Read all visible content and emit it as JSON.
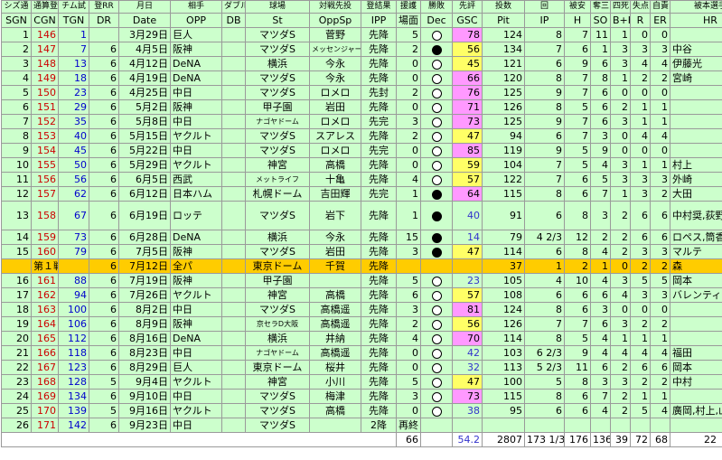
{
  "headers": {
    "row1": [
      "シズ通",
      "通算登",
      "チム試",
      "登RR",
      "月日",
      "相手",
      "ダブル",
      "球場",
      "対戦先投",
      "登結果",
      "援護",
      "勝敗",
      "先評",
      "投数",
      "回",
      "被安",
      "奪三",
      "四死",
      "失点",
      "自責",
      "被本選手"
    ],
    "row2": [
      "SGN",
      "CGN",
      "TGN",
      "DR",
      "Date",
      "OPP",
      "DB",
      "St",
      "OppSp",
      "IPP",
      "場面",
      "Dec",
      "GSC",
      "Pit",
      "IP",
      "H",
      "SO",
      "B+H",
      "R",
      "ER",
      "HR"
    ]
  },
  "rows": [
    {
      "sgn": "1",
      "cgn": "146",
      "tgn": "1",
      "dr": "",
      "date": "3月29日",
      "opp": "巨人",
      "db": "",
      "st": "マツダS",
      "oppsp": "菅野",
      "ipp": "先降",
      "run": "5",
      "dec": "nd",
      "gsc": "78",
      "pit": "124",
      "ip": "8",
      "h": "7",
      "so": "11",
      "bb": "1",
      "r": "0",
      "er": "0",
      "hr": ""
    },
    {
      "sgn": "2",
      "cgn": "147",
      "tgn": "7",
      "dr": "6",
      "date": "4月5日",
      "opp": "阪神",
      "db": "",
      "st": "マツダS",
      "oppsp": "メッセンジャー",
      "ipp": "先降",
      "run": "2",
      "dec": "win",
      "gsc": "56",
      "pit": "134",
      "ip": "7",
      "h": "6",
      "so": "1",
      "bb": "3",
      "r": "3",
      "er": "3",
      "hr": "中谷"
    },
    {
      "sgn": "3",
      "cgn": "148",
      "tgn": "13",
      "dr": "6",
      "date": "4月12日",
      "opp": "DeNA",
      "db": "",
      "st": "横浜",
      "oppsp": "今永",
      "ipp": "先降",
      "run": "0",
      "dec": "nd",
      "gsc": "45",
      "pit": "121",
      "ip": "6",
      "h": "9",
      "so": "6",
      "bb": "3",
      "r": "4",
      "er": "4",
      "hr": "伊藤光"
    },
    {
      "sgn": "4",
      "cgn": "149",
      "tgn": "18",
      "dr": "6",
      "date": "4月19日",
      "opp": "DeNA",
      "db": "",
      "st": "マツダS",
      "oppsp": "今永",
      "ipp": "先降",
      "run": "0",
      "dec": "nd",
      "gsc": "66",
      "pit": "120",
      "ip": "8",
      "h": "7",
      "so": "8",
      "bb": "1",
      "r": "2",
      "er": "2",
      "hr": "宮崎"
    },
    {
      "sgn": "5",
      "cgn": "150",
      "tgn": "23",
      "dr": "6",
      "date": "4月25日",
      "opp": "中日",
      "db": "",
      "st": "マツダS",
      "oppsp": "ロメロ",
      "ipp": "先封",
      "run": "2",
      "dec": "nd",
      "gsc": "76",
      "pit": "125",
      "ip": "9",
      "h": "7",
      "so": "6",
      "bb": "0",
      "r": "0",
      "er": "0",
      "hr": ""
    },
    {
      "sgn": "6",
      "cgn": "151",
      "tgn": "29",
      "dr": "6",
      "date": "5月2日",
      "opp": "阪神",
      "db": "",
      "st": "甲子園",
      "oppsp": "岩田",
      "ipp": "先降",
      "run": "0",
      "dec": "nd",
      "gsc": "71",
      "pit": "126",
      "ip": "8",
      "h": "5",
      "so": "6",
      "bb": "2",
      "r": "1",
      "er": "1",
      "hr": ""
    },
    {
      "sgn": "7",
      "cgn": "152",
      "tgn": "35",
      "dr": "6",
      "date": "5月8日",
      "opp": "中日",
      "db": "",
      "st": "ナゴヤドーム",
      "oppsp": "ロメロ",
      "ipp": "先完",
      "run": "3",
      "dec": "nd",
      "gsc": "73",
      "pit": "125",
      "ip": "9",
      "h": "7",
      "so": "6",
      "bb": "3",
      "r": "1",
      "er": "1",
      "hr": ""
    },
    {
      "sgn": "8",
      "cgn": "153",
      "tgn": "40",
      "dr": "6",
      "date": "5月15日",
      "opp": "ヤクルト",
      "db": "",
      "st": "マツダS",
      "oppsp": "スアレス",
      "ipp": "先降",
      "run": "2",
      "dec": "nd",
      "gsc": "47",
      "pit": "94",
      "ip": "6",
      "h": "7",
      "so": "3",
      "bb": "0",
      "r": "4",
      "er": "4",
      "hr": ""
    },
    {
      "sgn": "9",
      "cgn": "154",
      "tgn": "45",
      "dr": "6",
      "date": "5月22日",
      "opp": "中日",
      "db": "",
      "st": "マツダS",
      "oppsp": "ロメロ",
      "ipp": "先完",
      "run": "0",
      "dec": "nd",
      "gsc": "85",
      "pit": "119",
      "ip": "9",
      "h": "5",
      "so": "9",
      "bb": "0",
      "r": "0",
      "er": "0",
      "hr": ""
    },
    {
      "sgn": "10",
      "cgn": "155",
      "tgn": "50",
      "dr": "6",
      "date": "5月29日",
      "opp": "ヤクルト",
      "db": "",
      "st": "神宮",
      "oppsp": "高橋",
      "ipp": "先降",
      "run": "0",
      "dec": "nd",
      "gsc": "59",
      "pit": "104",
      "ip": "7",
      "h": "5",
      "so": "4",
      "bb": "3",
      "r": "1",
      "er": "1",
      "hr": "村上"
    },
    {
      "sgn": "11",
      "cgn": "156",
      "tgn": "56",
      "dr": "6",
      "date": "6月5日",
      "opp": "西武",
      "db": "",
      "st": "メットライフ",
      "oppsp": "十亀",
      "ipp": "先降",
      "run": "4",
      "dec": "nd",
      "gsc": "57",
      "pit": "122",
      "ip": "7",
      "h": "6",
      "so": "5",
      "bb": "3",
      "r": "3",
      "er": "3",
      "hr": "外崎"
    },
    {
      "sgn": "12",
      "cgn": "157",
      "tgn": "62",
      "dr": "6",
      "date": "6月12日",
      "opp": "日本ハム",
      "db": "",
      "st": "札幌ドーム",
      "oppsp": "吉田輝",
      "ipp": "先完",
      "run": "1",
      "dec": "win",
      "gsc": "64",
      "pit": "115",
      "ip": "8",
      "h": "6",
      "so": "7",
      "bb": "1",
      "r": "3",
      "er": "2",
      "hr": "大田"
    },
    {
      "sgn": "13",
      "cgn": "158",
      "tgn": "67",
      "dr": "6",
      "date": "6月19日",
      "opp": "ロッテ",
      "db": "",
      "st": "マツダS",
      "oppsp": "岩下",
      "ipp": "先降",
      "run": "1",
      "dec": "win",
      "gsc": "40",
      "pit": "91",
      "ip": "6",
      "h": "8",
      "so": "3",
      "bb": "2",
      "r": "6",
      "er": "6",
      "hr": "中村奨,荻野 田村,レアード",
      "tall": true
    },
    {
      "sgn": "14",
      "cgn": "159",
      "tgn": "73",
      "dr": "6",
      "date": "6月28日",
      "opp": "DeNA",
      "db": "",
      "st": "横浜",
      "oppsp": "今永",
      "ipp": "先降",
      "run": "15",
      "dec": "win",
      "gsc": "14",
      "pit": "79",
      "ip": "4 2/3",
      "h": "12",
      "so": "2",
      "bb": "2",
      "r": "6",
      "er": "6",
      "hr": "ロペス,筒香,ソト"
    },
    {
      "sgn": "15",
      "cgn": "160",
      "tgn": "79",
      "dr": "6",
      "date": "7月5日",
      "opp": "阪神",
      "db": "",
      "st": "マツダS",
      "oppsp": "岩田",
      "ipp": "先降",
      "run": "3",
      "dec": "win",
      "gsc": "47",
      "pit": "114",
      "ip": "6",
      "h": "8",
      "so": "4",
      "bb": "2",
      "r": "3",
      "er": "3",
      "hr": "マルテ"
    },
    {
      "sgn": "",
      "cgn": "第１戦",
      "tgn": "",
      "dr": "6",
      "date": "7月12日",
      "opp": "全パ",
      "db": "",
      "st": "東京ドーム",
      "oppsp": "千賀",
      "ipp": "先降",
      "run": "",
      "dec": "",
      "gsc": "",
      "pit": "37",
      "ip": "1",
      "h": "2",
      "so": "1",
      "bb": "0",
      "r": "2",
      "er": "2",
      "hr": "森",
      "allstar": true
    },
    {
      "sgn": "16",
      "cgn": "161",
      "tgn": "88",
      "dr": "6",
      "date": "7月19日",
      "opp": "阪神",
      "db": "",
      "st": "甲子園",
      "oppsp": "",
      "ipp": "先降",
      "run": "5",
      "dec": "nd",
      "gsc": "23",
      "pit": "105",
      "ip": "4",
      "h": "10",
      "so": "4",
      "bb": "3",
      "r": "5",
      "er": "5",
      "hr": "岡本"
    },
    {
      "sgn": "17",
      "cgn": "162",
      "tgn": "94",
      "dr": "6",
      "date": "7月26日",
      "opp": "ヤクルト",
      "db": "",
      "st": "神宮",
      "oppsp": "高橋",
      "ipp": "先降",
      "run": "6",
      "dec": "nd",
      "gsc": "57",
      "pit": "108",
      "ip": "6",
      "h": "6",
      "so": "6",
      "bb": "4",
      "r": "3",
      "er": "3",
      "hr": "バレンティン"
    },
    {
      "sgn": "18",
      "cgn": "163",
      "tgn": "100",
      "dr": "6",
      "date": "8月2日",
      "opp": "中日",
      "db": "",
      "st": "マツダS",
      "oppsp": "高橋遥",
      "ipp": "先降",
      "run": "3",
      "dec": "nd",
      "gsc": "81",
      "pit": "124",
      "ip": "8",
      "h": "6",
      "so": "3",
      "bb": "0",
      "r": "0",
      "er": "0",
      "hr": ""
    },
    {
      "sgn": "19",
      "cgn": "164",
      "tgn": "106",
      "dr": "6",
      "date": "8月9日",
      "opp": "阪神",
      "db": "",
      "st": "京セラD大阪",
      "oppsp": "高橋遥",
      "ipp": "先降",
      "run": "2",
      "dec": "nd",
      "gsc": "56",
      "pit": "126",
      "ip": "7",
      "h": "7",
      "so": "6",
      "bb": "3",
      "r": "2",
      "er": "2",
      "hr": ""
    },
    {
      "sgn": "20",
      "cgn": "165",
      "tgn": "112",
      "dr": "6",
      "date": "8月16日",
      "opp": "DeNA",
      "db": "",
      "st": "横浜",
      "oppsp": "井納",
      "ipp": "先降",
      "run": "4",
      "dec": "nd",
      "gsc": "70",
      "pit": "114",
      "ip": "8",
      "h": "5",
      "so": "4",
      "bb": "1",
      "r": "1",
      "er": "1",
      "hr": ""
    },
    {
      "sgn": "21",
      "cgn": "166",
      "tgn": "118",
      "dr": "6",
      "date": "8月23日",
      "opp": "中日",
      "db": "",
      "st": "ナゴヤドーム",
      "oppsp": "高橋遥",
      "ipp": "先降",
      "run": "0",
      "dec": "nd",
      "gsc": "42",
      "pit": "103",
      "ip": "6 2/3",
      "h": "9",
      "so": "4",
      "bb": "4",
      "r": "4",
      "er": "4",
      "hr": "福田"
    },
    {
      "sgn": "22",
      "cgn": "167",
      "tgn": "123",
      "dr": "6",
      "date": "8月29日",
      "opp": "巨人",
      "db": "",
      "st": "東京ドーム",
      "oppsp": "桜井",
      "ipp": "先降",
      "run": "0",
      "dec": "nd",
      "gsc": "32",
      "pit": "113",
      "ip": "5 2/3",
      "h": "11",
      "so": "6",
      "bb": "2",
      "r": "6",
      "er": "6",
      "hr": "岡本"
    },
    {
      "sgn": "23",
      "cgn": "168",
      "tgn": "128",
      "dr": "5",
      "date": "9月4日",
      "opp": "ヤクルト",
      "db": "",
      "st": "神宮",
      "oppsp": "小川",
      "ipp": "先降",
      "run": "5",
      "dec": "nd",
      "gsc": "47",
      "pit": "100",
      "ip": "5",
      "h": "8",
      "so": "3",
      "bb": "3",
      "r": "2",
      "er": "2",
      "hr": "中村"
    },
    {
      "sgn": "24",
      "cgn": "169",
      "tgn": "134",
      "dr": "6",
      "date": "9月10日",
      "opp": "中日",
      "db": "",
      "st": "マツダS",
      "oppsp": "梅津",
      "ipp": "先降",
      "run": "3",
      "dec": "nd",
      "gsc": "73",
      "pit": "115",
      "ip": "8",
      "h": "6",
      "so": "7",
      "bb": "2",
      "r": "1",
      "er": "1",
      "hr": ""
    },
    {
      "sgn": "25",
      "cgn": "170",
      "tgn": "139",
      "dr": "5",
      "date": "9月16日",
      "opp": "ヤクルト",
      "db": "",
      "st": "マツダS",
      "oppsp": "高橋",
      "ipp": "先降",
      "run": "0",
      "dec": "nd",
      "gsc": "38",
      "pit": "95",
      "ip": "6",
      "h": "6",
      "so": "4",
      "bb": "2",
      "r": "5",
      "er": "4",
      "hr": "廣岡,村上,山田"
    },
    {
      "sgn": "26",
      "cgn": "171",
      "tgn": "142",
      "dr": "6",
      "date": "9月23日",
      "opp": "中日",
      "db": "",
      "st": "マツダS",
      "oppsp": "",
      "ipp": "2降",
      "run": "再終",
      "dec": "",
      "gsc": "",
      "pit": "",
      "ip": "",
      "h": "",
      "so": "",
      "bb": "",
      "r": "",
      "er": "",
      "hr": ""
    }
  ],
  "totals": {
    "run": "66",
    "gsc": "54.2",
    "pit": "2807",
    "ip": "173 1/3",
    "h": "176",
    "so": "136",
    "bb": "39",
    "r": "72",
    "er": "68",
    "hr": "22"
  },
  "colors": {
    "header_bg": "#ccffcc",
    "row_bg": "#ccffcc",
    "allstar_bg": "#ffcc00",
    "gsc_high": "#ffff66",
    "gsc_mid": "#ff99ff",
    "gsc_low_text": "#3333cc",
    "cgn_text": "#cc0000",
    "tgn_text": "#0000cc"
  }
}
